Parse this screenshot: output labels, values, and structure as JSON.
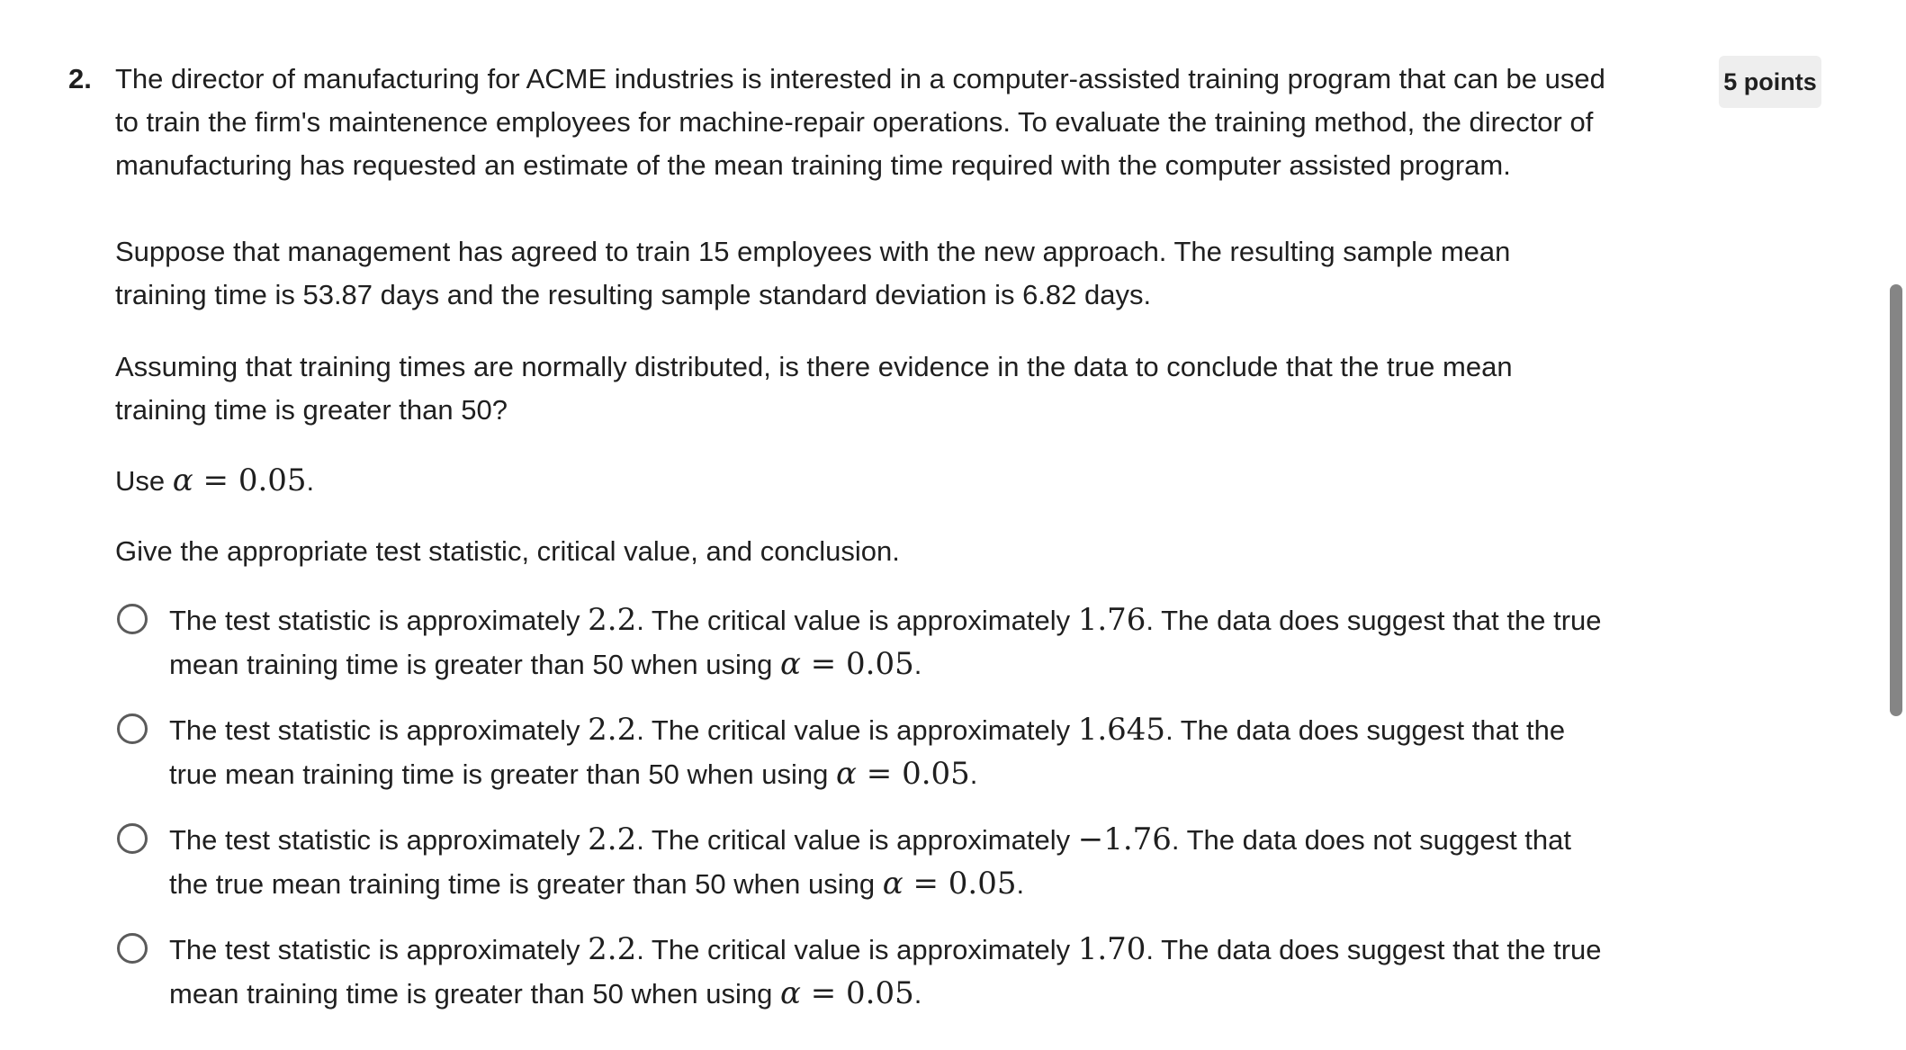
{
  "question": {
    "number": "2.",
    "points": "5 points",
    "intro": "The director of manufacturing for ACME industries is interested in a computer-assisted training program that can be used to train the firm's maintenence employees for machine-repair operations. To evaluate the training method, the director of manufacturing has requested an estimate of the mean training time required with the computer assisted program.",
    "setup": "Suppose that management has agreed to train 15 employees with the new approach. The resulting sample mean training time is 53.87 days and the resulting sample standard deviation is 6.82 days.",
    "question_text": "Assuming that training times are normally distributed, is there evidence in the data to conclude that the true mean training time is greater than 50?",
    "alpha_line": {
      "prefix": "Use ",
      "alpha_symbol": "α",
      "equals": " = ",
      "value": "0.05",
      "suffix": "."
    },
    "prompt": "Give the appropriate test statistic, critical value, and conclusion."
  },
  "options": [
    {
      "p1": "The test statistic is approximately ",
      "stat": "2.2",
      "p2": ". The critical value is approximately ",
      "crit": "1.76",
      "p3": ". The data does suggest that the true mean training time is greater than 50 when using ",
      "alpha": "α",
      "eq": " = ",
      "alpha_val": "0.05",
      "end": "."
    },
    {
      "p1": "The test statistic is approximately ",
      "stat": "2.2",
      "p2": ". The critical value is approximately ",
      "crit": "1.645",
      "p3": ". The data does suggest that the true mean training time is greater than 50 when using ",
      "alpha": "α",
      "eq": " = ",
      "alpha_val": "0.05",
      "end": "."
    },
    {
      "p1": "The test statistic is approximately ",
      "stat": "2.2",
      "p2": ". The critical value is approximately ",
      "crit": "−1.76",
      "p3": ". The data does not suggest that the true mean training time is greater than 50 when using ",
      "alpha": "α",
      "eq": " = ",
      "alpha_val": "0.05",
      "end": "."
    },
    {
      "p1": "The test statistic is approximately ",
      "stat": "2.2",
      "p2": ". The critical value is approximately ",
      "crit": "1.70",
      "p3": ". The data does suggest that the true mean training time is greater than 50 when using ",
      "alpha": "α",
      "eq": " = ",
      "alpha_val": "0.05",
      "end": "."
    }
  ]
}
